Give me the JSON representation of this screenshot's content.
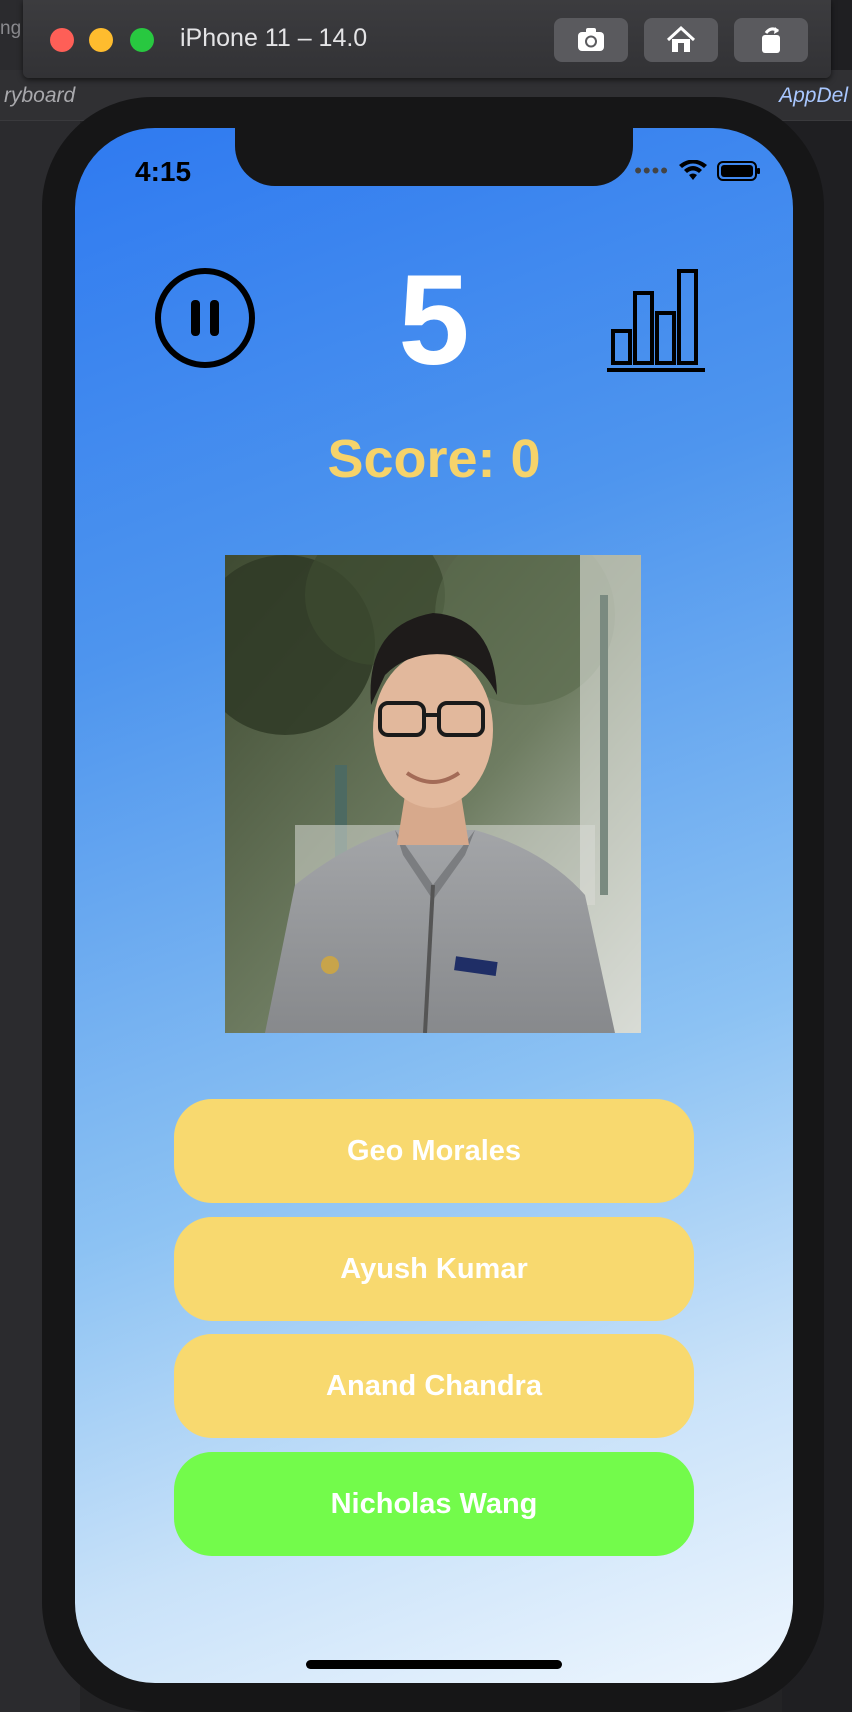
{
  "simulator": {
    "title": "iPhone 11 – 14.0",
    "buttons": [
      "screenshot-icon",
      "home-icon",
      "rotate-icon"
    ]
  },
  "background": {
    "left_word": "ryboard",
    "left_top": "ng",
    "right_word": "AppDel"
  },
  "status_bar": {
    "time": "4:15"
  },
  "game": {
    "timer": "5",
    "score_label": "Score: 0",
    "pause_icon": "pause-icon",
    "stats_icon": "bar-chart-icon"
  },
  "answers": [
    {
      "label": "Geo Morales",
      "state": "default"
    },
    {
      "label": "Ayush Kumar",
      "state": "default"
    },
    {
      "label": "Anand Chandra",
      "state": "default"
    },
    {
      "label": "Nicholas Wang",
      "state": "correct"
    }
  ],
  "colors": {
    "accent_yellow": "#f8d96f",
    "correct_green": "#73fb4b",
    "score_text": "#f6d36a",
    "gradient_start": "#2f7af0",
    "gradient_end": "#eef6fe"
  }
}
